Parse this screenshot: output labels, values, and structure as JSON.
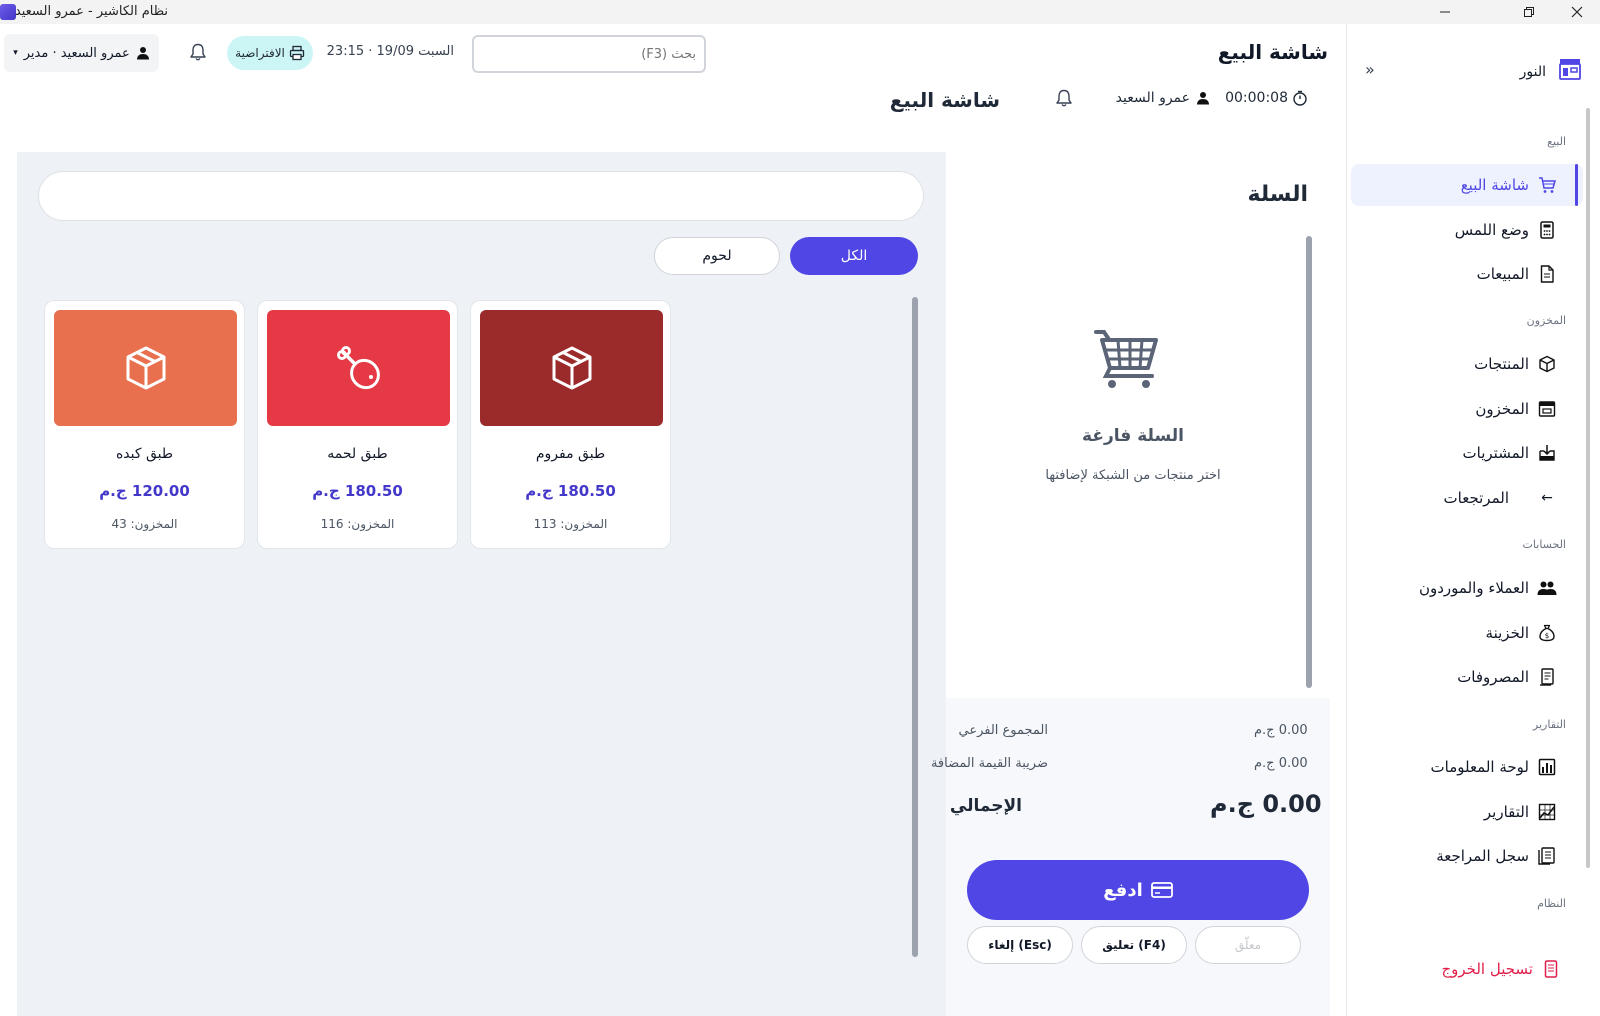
{
  "window": {
    "title": "نظام الكاشير - عمرو السعيد"
  },
  "header": {
    "title": "شاشة البيع",
    "search_placeholder": "بحث (F3)",
    "datetime": "السبت 19/09 · 23:15",
    "printer_label": "الافتراضية",
    "user_menu": "عمرو السعيد · مدير"
  },
  "sidebar": {
    "brand": "النور",
    "collapse": "»",
    "sections": {
      "sales": "البيع",
      "inventory": "المخزون",
      "accounts": "الحسابات",
      "reports": "التقارير",
      "system": "النظام"
    },
    "items": {
      "pos": "شاشة البيع",
      "touch": "وضع اللمس",
      "sales": "المبيعات",
      "products": "المنتجات",
      "stock": "المخزون",
      "purchases": "المشتريات",
      "returns": "المرتجعات",
      "customers": "العملاء والموردون",
      "treasury": "الخزينة",
      "expenses": "المصروفات",
      "dashboard": "لوحة المعلومات",
      "reports": "التقارير",
      "audit": "سجل المراجعة",
      "logout": "تسجيل الخروج"
    },
    "returns_arrow": "←"
  },
  "subheader": {
    "title": "شاشة البيع",
    "user": "عمرو السعيد",
    "timer": "00:00:08"
  },
  "cart": {
    "title": "السلة",
    "empty_title": "السلة فارغة",
    "empty_hint": "اختر منتجات من الشبكة لإضافتها",
    "subtotal_label": "المجموع الفرعي",
    "subtotal_value": "0.00 ج.م",
    "vat_label": "ضريبة القيمة المضافة",
    "vat_value": "0.00 ج.م",
    "total_label": "الإجمالي",
    "total_value": "0.00 ج.م",
    "pay_label": "ادفع",
    "hold_label": "معلّق",
    "suspend_label": "(F4) تعليق",
    "cancel_label": "(Esc) إلغاء"
  },
  "categories": {
    "all": "الكل",
    "meat": "لحوم"
  },
  "products": [
    {
      "name": "طبق مفروم",
      "price": "180.50 ج.م",
      "stock": "المخزون: 113",
      "color": "#9b2b2b",
      "icon": "box-icon"
    },
    {
      "name": "طبق لحمه",
      "price": "180.50 ج.م",
      "stock": "المخزون: 116",
      "color": "#e63946",
      "icon": "drumstick-icon"
    },
    {
      "name": "طبق كبده",
      "price": "120.00 ج.م",
      "stock": "المخزون: 43",
      "color": "#e8704e",
      "icon": "box-icon"
    }
  ],
  "colors": {
    "accent": "#4f46e5",
    "logout": "#e11d48",
    "printer_badge": "#ccf5f5"
  }
}
